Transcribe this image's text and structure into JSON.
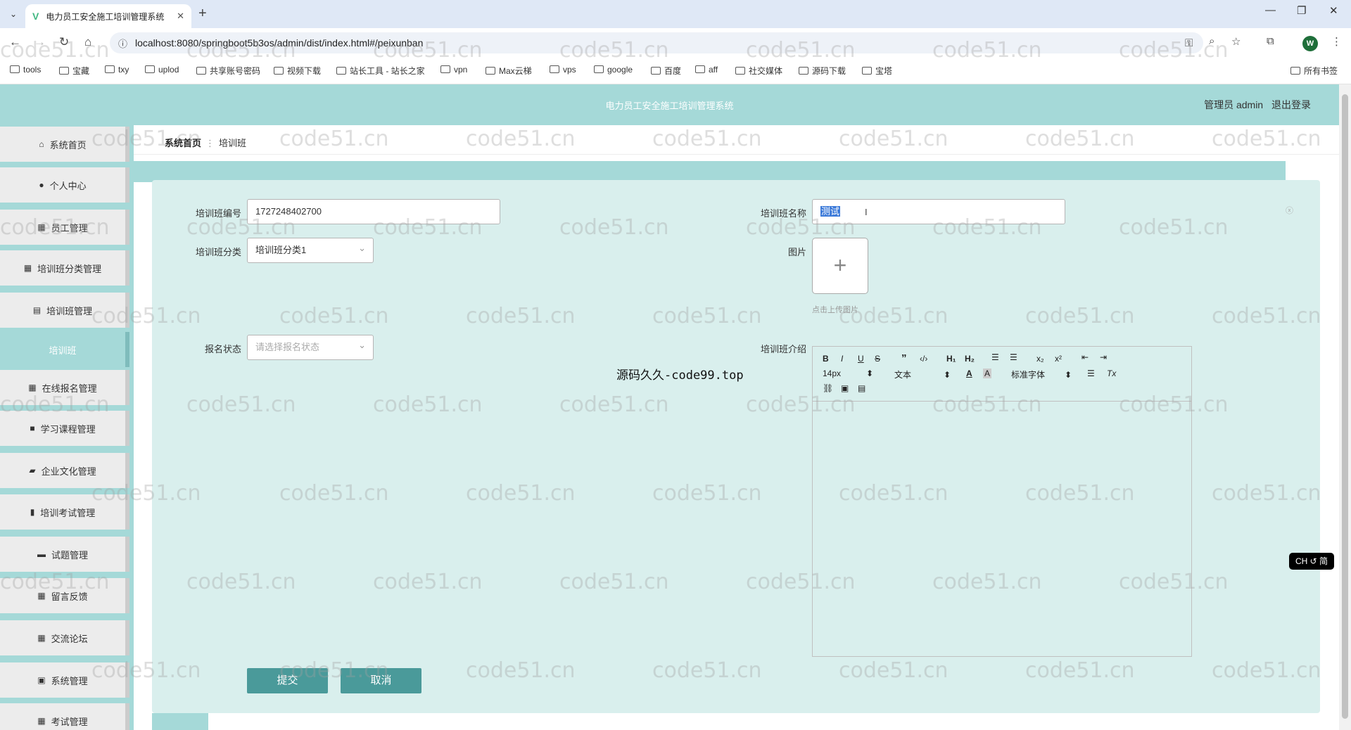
{
  "browser": {
    "tab_title": "电力员工安全施工培训管理系统",
    "tab_close": "✕",
    "new_tab": "+",
    "url": "localhost:8080/springboot5b3os/admin/dist/index.html#/peixunban",
    "profile_initial": "W",
    "bookmarks": [
      "tools",
      "宝藏",
      "txy",
      "uplod",
      "共享账号密码",
      "视频下载",
      "站长工具 - 站长之家",
      "vpn",
      "Max云梯",
      "vps",
      "google",
      "百度",
      "aff",
      "社交媒体",
      "源码下载",
      "宝塔"
    ],
    "all_bookmarks": "所有书签"
  },
  "header": {
    "app_title": "电力员工安全施工培训管理系统",
    "role": "管理员 admin",
    "logout": "退出登录"
  },
  "sidebar": {
    "items": [
      {
        "label": "系统首页",
        "icon": "home-icon"
      },
      {
        "label": "个人中心",
        "icon": "user-icon"
      },
      {
        "label": "员工管理",
        "icon": "grid-icon"
      },
      {
        "label": "培训班分类管理",
        "icon": "grid-icon"
      },
      {
        "label": "培训班管理",
        "icon": "clipboard-icon"
      },
      {
        "label": "培训班",
        "icon": ""
      },
      {
        "label": "在线报名管理",
        "icon": "grid-icon"
      },
      {
        "label": "学习课程管理",
        "icon": "briefcase-icon"
      },
      {
        "label": "企业文化管理",
        "icon": "flag-icon"
      },
      {
        "label": "培训考试管理",
        "icon": "bar-chart-icon"
      },
      {
        "label": "试题管理",
        "icon": "monitor-icon"
      },
      {
        "label": "留言反馈",
        "icon": "grid-icon"
      },
      {
        "label": "交流论坛",
        "icon": "grid-icon"
      },
      {
        "label": "系统管理",
        "icon": "doc-icon"
      },
      {
        "label": "考试管理",
        "icon": "grid-icon"
      }
    ]
  },
  "breadcrumb": {
    "home": "系统首页",
    "sep": "⋮",
    "current": "培训班"
  },
  "form": {
    "code_label": "培训班编号",
    "code_value": "1727248402700",
    "name_label": "培训班名称",
    "name_value": "测试",
    "category_label": "培训班分类",
    "category_value": "培训班分类1",
    "image_label": "图片",
    "upload_tip": "点击上传图片",
    "status_label": "报名状态",
    "status_placeholder": "请选择报名状态",
    "intro_label": "培训班介绍",
    "editor": {
      "font_size": "14px",
      "text_type": "文本",
      "font_family": "标准字体"
    },
    "submit": "提交",
    "cancel": "取消"
  },
  "overlay_text": "源码久久-code99.top",
  "watermark": "code51.cn",
  "ime": "CH ↺ 简"
}
